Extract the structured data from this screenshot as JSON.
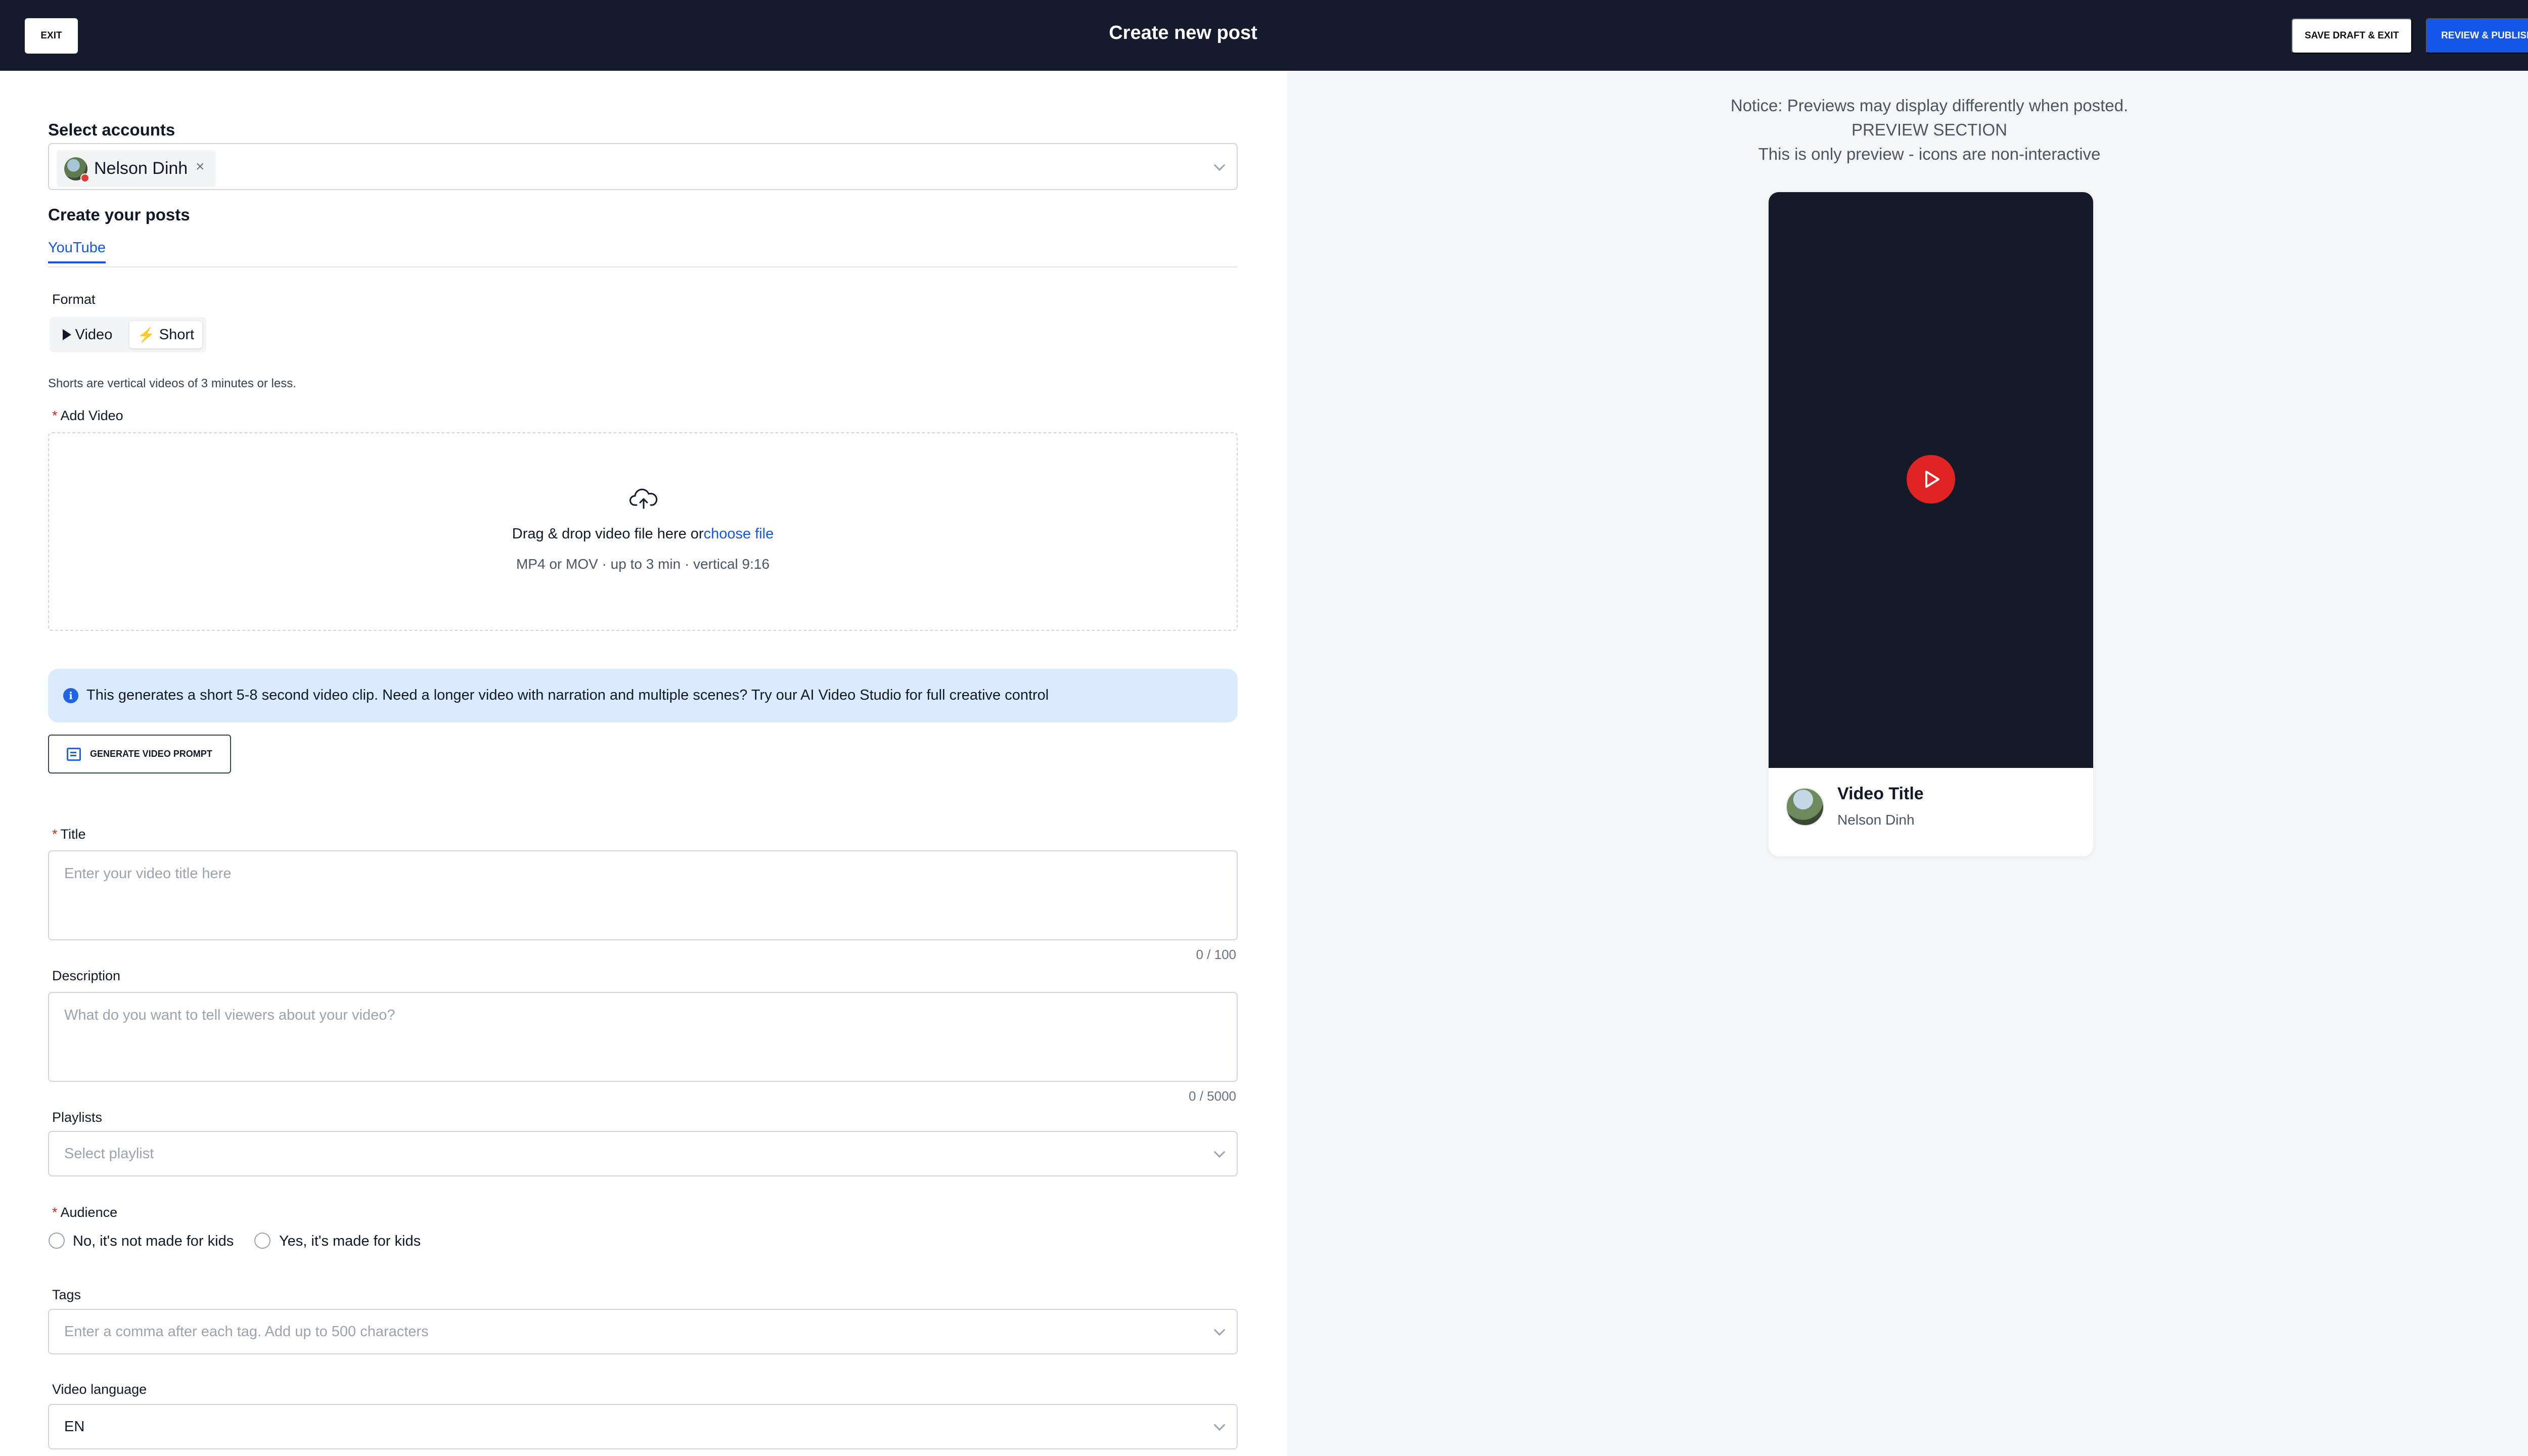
{
  "header": {
    "exit_label": "EXIT",
    "title": "Create new post",
    "save_draft_label": "SAVE DRAFT & EXIT",
    "publish_label": "REVIEW & PUBLISH",
    "publish_color": "#1456e8",
    "bg_color": "#151b2c"
  },
  "form": {
    "accounts_label": "Select accounts",
    "selected_account": "Nelson Dinh",
    "remove_icon": "×",
    "create_label": "Create your posts",
    "tabs": [
      {
        "label": "YouTube",
        "active": true
      }
    ],
    "format_label": "Format",
    "format_options": [
      {
        "label": "Video",
        "icon": "play-icon",
        "selected": false
      },
      {
        "label": "Short",
        "icon": "bolt-icon",
        "selected": true
      }
    ],
    "short_hint": "Shorts are vertical videos of 3 minutes or less.",
    "add_video_label": "Add Video",
    "required_mark": "*",
    "dropzone": {
      "text": "Drag & drop video file here or",
      "link": "choose file",
      "subtext": "MP4 or MOV · up to 3 min · vertical 9:16",
      "icon": "cloud-upload-icon"
    },
    "info_banner": {
      "icon": "info-icon",
      "text": "This generates a short 5-8 second video clip. Need a longer video with narration and multiple scenes? Try our AI Video Studio for full creative control"
    },
    "generate_button_label": "GENERATE VIDEO PROMPT",
    "title_field": {
      "label": "Title",
      "placeholder": "Enter your video title here",
      "counter": "0 / 100"
    },
    "description_field": {
      "label": "Description",
      "placeholder": "What do you want to tell viewers about your video?",
      "counter": "0 / 5000"
    },
    "playlists": {
      "label": "Playlists",
      "placeholder": "Select playlist"
    },
    "audience": {
      "label": "Audience",
      "options": [
        "No, it's not made for kids",
        "Yes, it's made for kids"
      ]
    },
    "tags": {
      "label": "Tags",
      "placeholder": "Enter a comma after each tag. Add up to 500 characters"
    },
    "language": {
      "label": "Video language",
      "value": "EN"
    }
  },
  "preview": {
    "notice_lines": [
      "Notice: Previews may display differently when posted.",
      "PREVIEW SECTION",
      "This is only preview - icons are non-interactive"
    ],
    "video_title": "Video Title",
    "channel_name": "Nelson Dinh",
    "play_color": "#e02424"
  }
}
